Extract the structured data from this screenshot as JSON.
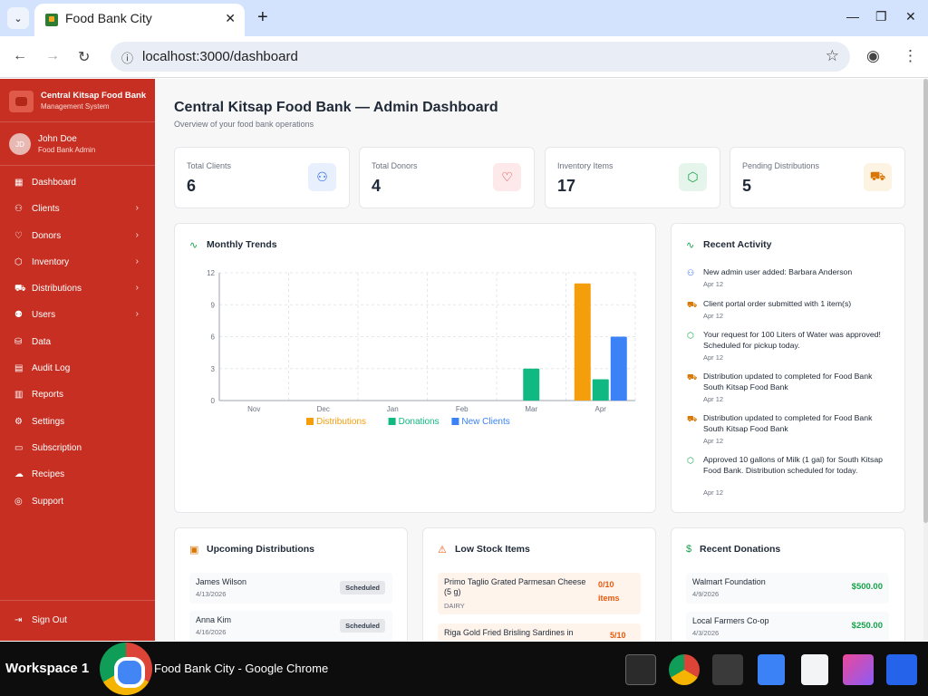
{
  "browser": {
    "tab_title": "Food Bank City",
    "url": "localhost:3000/dashboard"
  },
  "sidebar": {
    "brand_name": "Central Kitsap Food Bank",
    "brand_sub": "Management System",
    "user_initials": "JD",
    "user_name": "John Doe",
    "user_role": "Food Bank Admin",
    "items": [
      {
        "label": "Dashboard",
        "icon": "grid-icon"
      },
      {
        "label": "Clients",
        "icon": "users-icon"
      },
      {
        "label": "Donors",
        "icon": "heart-icon"
      },
      {
        "label": "Inventory",
        "icon": "box-icon"
      },
      {
        "label": "Distributions",
        "icon": "truck-icon"
      },
      {
        "label": "Users",
        "icon": "user-cog-icon"
      },
      {
        "label": "Data",
        "icon": "database-icon"
      },
      {
        "label": "Audit Log",
        "icon": "clipboard-icon"
      },
      {
        "label": "Reports",
        "icon": "bar-chart-icon"
      },
      {
        "label": "Settings",
        "icon": "gear-icon"
      },
      {
        "label": "Subscription",
        "icon": "credit-card-icon"
      },
      {
        "label": "Recipes",
        "icon": "chef-hat-icon"
      },
      {
        "label": "Support",
        "icon": "help-circle-icon"
      }
    ],
    "sign_out": "Sign Out"
  },
  "page": {
    "title": "Central Kitsap Food Bank — Admin Dashboard",
    "subtitle": "Overview of your food bank operations"
  },
  "stats": [
    {
      "label": "Total Clients",
      "value": "6",
      "icon": "users-icon",
      "color": "#2563eb",
      "bg": "#e8f0fe"
    },
    {
      "label": "Total Donors",
      "value": "4",
      "icon": "heart-icon",
      "color": "#dc2626",
      "bg": "#fde8ea"
    },
    {
      "label": "Inventory Items",
      "value": "17",
      "icon": "box-icon",
      "color": "#16a34a",
      "bg": "#e6f5ec"
    },
    {
      "label": "Pending Distributions",
      "value": "5",
      "icon": "truck-icon",
      "color": "#d97706",
      "bg": "#fdf3e2"
    }
  ],
  "trends": {
    "title": "Monthly Trends"
  },
  "chart_data": {
    "type": "bar",
    "categories": [
      "Nov",
      "Dec",
      "Jan",
      "Feb",
      "Mar",
      "Apr"
    ],
    "series": [
      {
        "name": "Distributions",
        "color": "#f59e0b",
        "values": [
          0,
          0,
          0,
          0,
          0,
          11
        ]
      },
      {
        "name": "Donations",
        "color": "#10b981",
        "values": [
          0,
          0,
          0,
          0,
          3,
          2
        ]
      },
      {
        "name": "New Clients",
        "color": "#3b82f6",
        "values": [
          0,
          0,
          0,
          0,
          0,
          6
        ]
      }
    ],
    "yticks": [
      "0",
      "3",
      "6",
      "9",
      "12"
    ],
    "ylim": [
      0,
      12
    ],
    "grid": true,
    "legend": "bottom"
  },
  "activity": {
    "title": "Recent Activity",
    "items": [
      {
        "text": "New admin user added: Barbara Anderson",
        "date": "Apr 12",
        "icon": "users-icon",
        "color": "#2563eb"
      },
      {
        "text": "Client portal order submitted with 1 item(s)",
        "date": "Apr 12",
        "icon": "truck-icon",
        "color": "#d97706"
      },
      {
        "text": "Your request for 100 Liters of Water was approved! Scheduled for pickup today.",
        "date": "Apr 12",
        "icon": "box-icon",
        "color": "#16a34a"
      },
      {
        "text": "Distribution updated to completed for Food Bank South Kitsap Food Bank",
        "date": "Apr 12",
        "icon": "truck-icon",
        "color": "#d97706"
      },
      {
        "text": "Distribution updated to completed for Food Bank South Kitsap Food Bank",
        "date": "Apr 12",
        "icon": "truck-icon",
        "color": "#d97706"
      },
      {
        "text": "Approved 10 gallons of Milk (1 gal) for South Kitsap Food Bank. Distribution scheduled for today.",
        "date": "Apr 12",
        "icon": "box-icon",
        "color": "#16a34a"
      }
    ]
  },
  "upcoming": {
    "title": "Upcoming Distributions",
    "rows": [
      {
        "name": "James Wilson",
        "date": "4/13/2026",
        "status": "Scheduled"
      },
      {
        "name": "Anna Kim",
        "date": "4/16/2026",
        "status": "Scheduled"
      }
    ]
  },
  "low_stock": {
    "title": "Low Stock Items",
    "rows": [
      {
        "name": "Primo Taglio Grated Parmesan Cheese (5 g)",
        "category": "DAIRY",
        "qty": "0/10",
        "unit": "items"
      },
      {
        "name": "Riga Gold Fried Brisling Sardines in",
        "category": "",
        "qty": "5/10",
        "unit": ""
      }
    ]
  },
  "donations": {
    "title": "Recent Donations",
    "rows": [
      {
        "name": "Walmart Foundation",
        "date": "4/9/2026",
        "amount": "$500.00"
      },
      {
        "name": "Local Farmers Co-op",
        "date": "4/3/2026",
        "amount": "$250.00"
      }
    ]
  },
  "taskbar": {
    "workspace": "Workspace 1",
    "window_title": "Food Bank City - Google Chrome"
  }
}
